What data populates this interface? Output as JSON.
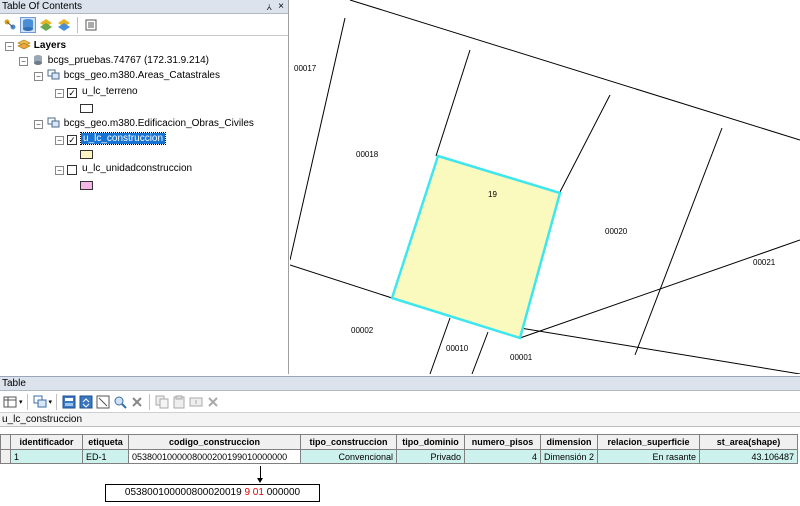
{
  "toc": {
    "title": "Table Of Contents",
    "pin_glyph": "⩑",
    "close_glyph": "×",
    "root": "Layers",
    "connection": "bcgs_pruebas.74767 (172.31.9.214)",
    "groups": [
      {
        "name": "bcgs_geo.m380.Areas_Catastrales",
        "layers": [
          {
            "name": "u_lc_terreno",
            "checked": true,
            "selected": false,
            "swatch": "#ffffff"
          }
        ]
      },
      {
        "name": "bcgs_geo.m380.Edificacion_Obras_Civiles",
        "layers": [
          {
            "name": "u_lc_construccion",
            "checked": true,
            "selected": true,
            "swatch": "#fff5c2"
          },
          {
            "name": "u_lc_unidadconstruccion",
            "checked": false,
            "selected": false,
            "swatch": "#f3b8e6"
          }
        ]
      }
    ]
  },
  "map": {
    "labels": [
      "00017",
      "00018",
      "19",
      "00020",
      "00021",
      "00002",
      "00010",
      "00001"
    ],
    "highlight_fill": "#fafabe",
    "highlight_stroke": "#3fe6ee"
  },
  "table": {
    "title": "Table",
    "layer_name": "u_lc_construccion",
    "columns": [
      "identificador",
      "etiqueta",
      "codigo_construccion",
      "tipo_construccion",
      "tipo_dominio",
      "numero_pisos",
      "dimension",
      "relacion_superficie",
      "st_area(shape)"
    ],
    "rows": [
      [
        "1",
        "ED-1",
        "0538001000008000200199010000000",
        "Convencional",
        "Privado",
        "4",
        "Dimensión 2",
        "En rasante",
        "43.106487"
      ]
    ]
  },
  "annotation": {
    "prefix": "053800100000800020019",
    "highlight": "9 01",
    "suffix": "000000"
  },
  "colors": {
    "selection_blue": "#1874d2",
    "row_highlight": "#cdf2ee",
    "annotation_red": "#e00000"
  }
}
